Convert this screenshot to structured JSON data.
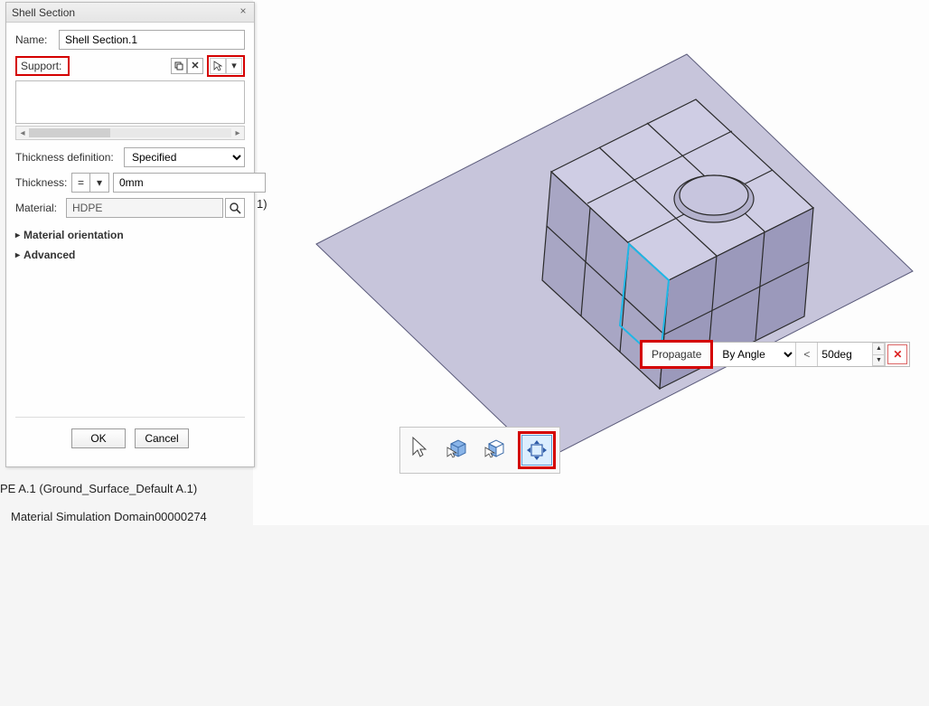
{
  "dialog": {
    "title": "Shell Section",
    "name_label": "Name:",
    "name_value": "Shell Section.1",
    "support_label": "Support:",
    "thickness_def_label": "Thickness definition:",
    "thickness_def_value": "Specified",
    "thickness_label": "Thickness:",
    "thickness_value": "0mm",
    "material_label": "Material:",
    "material_value": "HDPE",
    "orientation_header": "Material orientation",
    "advanced_header": "Advanced",
    "ok": "OK",
    "cancel": "Cancel"
  },
  "propagate": {
    "button": "Propagate",
    "mode": "By Angle",
    "op": "<",
    "value": "50deg"
  },
  "annotations": {
    "line1_suffix": "1)",
    "line2": "PE A.1 (Ground_Surface_Default A.1)",
    "line3": "Material Simulation Domain00000274"
  }
}
